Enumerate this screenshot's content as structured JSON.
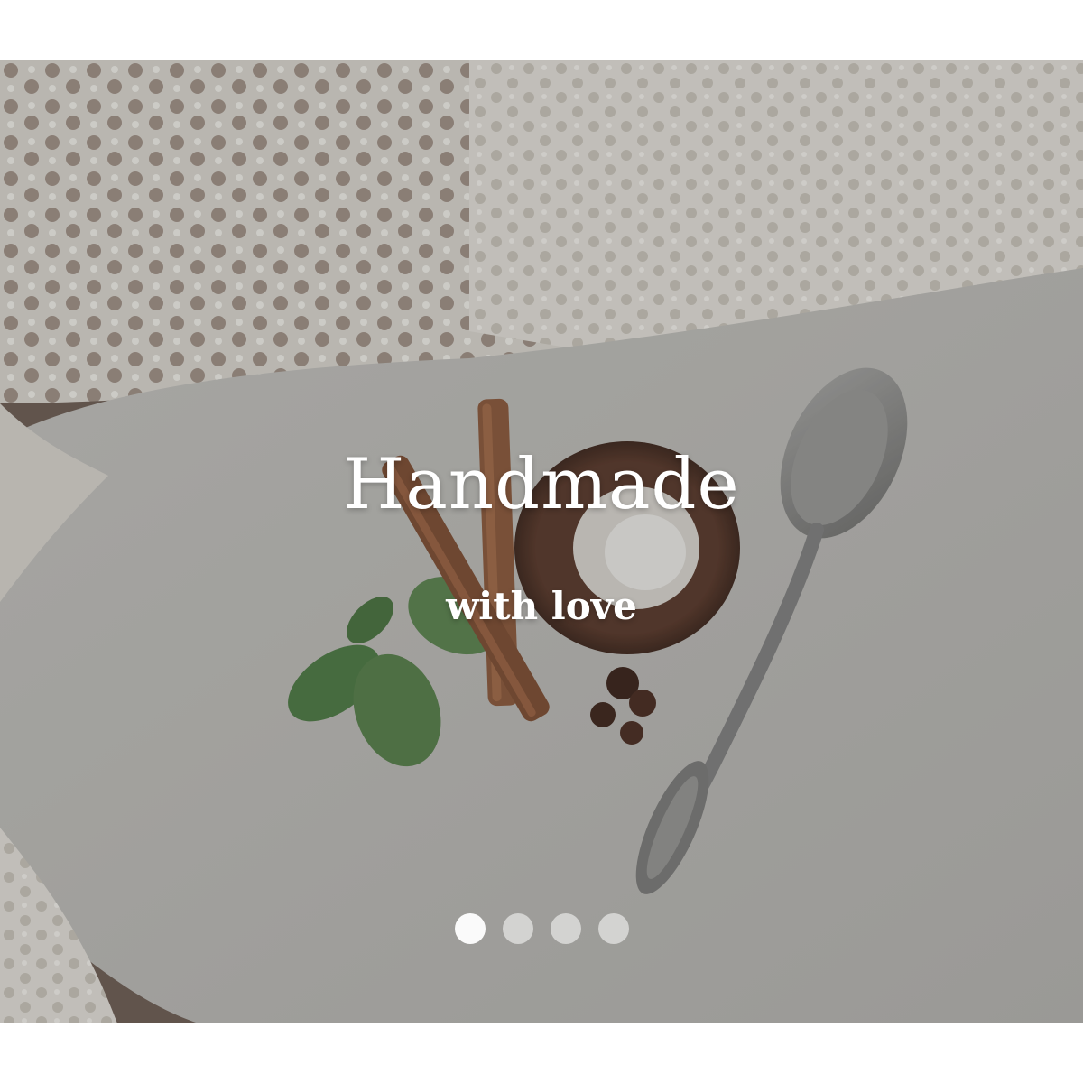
{
  "hero": {
    "title": "Handmade",
    "subtitle": "with love",
    "image_description_icon": "photo-illustration"
  },
  "carousel": {
    "slide_count": 4,
    "active_index": 0,
    "dots": [
      {
        "state": "active"
      },
      {
        "state": "inactive"
      },
      {
        "state": "inactive"
      },
      {
        "state": "inactive"
      }
    ]
  },
  "colors": {
    "text": "#ffffff",
    "background": "#ffffff",
    "linen": "#c9c8c4",
    "lace": "#e6e3dc",
    "wood": "#6b4a3a",
    "mint": "#4e7a45",
    "spoon": "#8f8f8f"
  }
}
